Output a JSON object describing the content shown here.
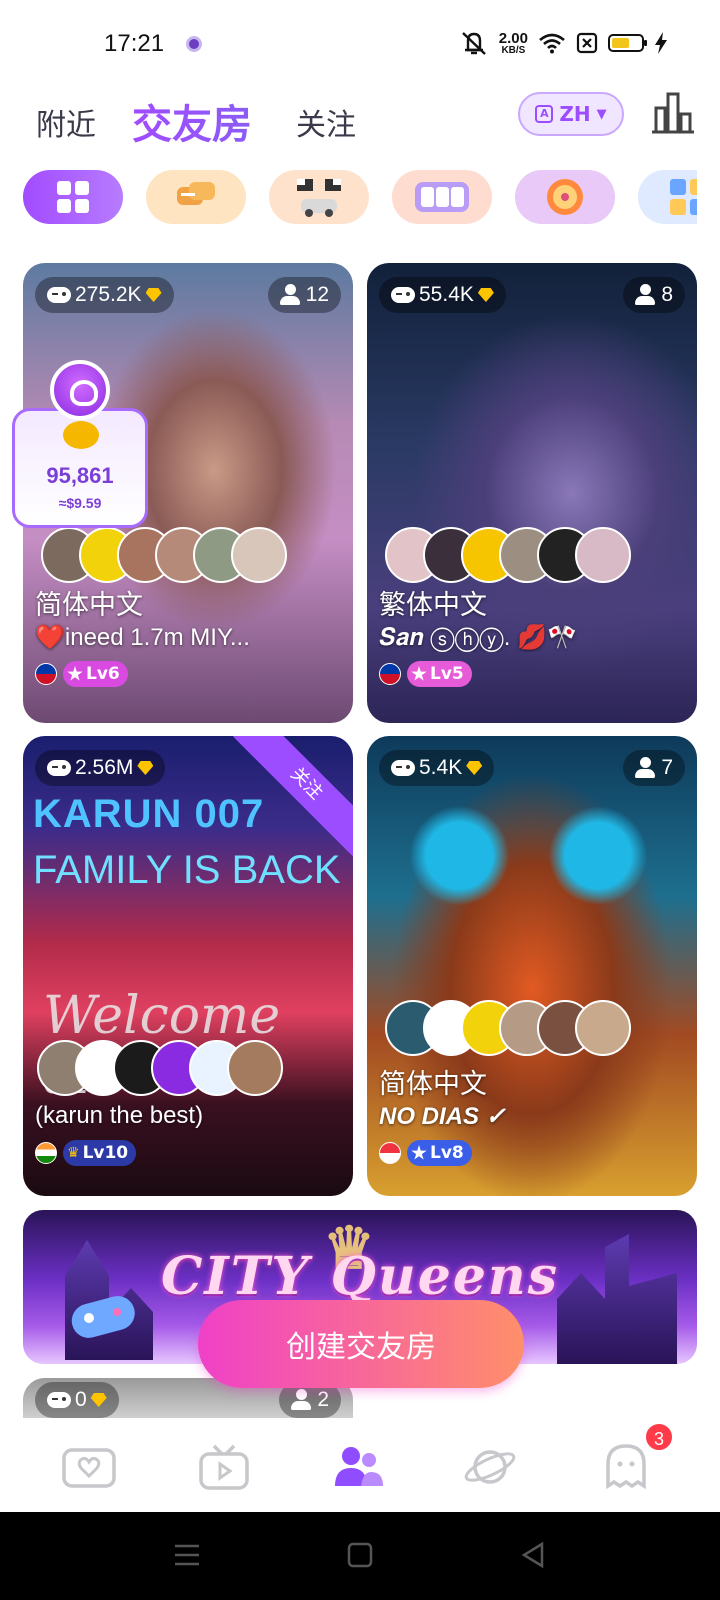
{
  "status_bar": {
    "time": "17:21",
    "net_speed": "2.00",
    "net_unit": "KB/S",
    "battery_level_percent": 60
  },
  "top_nav": {
    "tabs": [
      {
        "label": "附近",
        "active": false
      },
      {
        "label": "交友房",
        "active": true
      },
      {
        "label": "关注",
        "active": false
      }
    ],
    "language_button": "ZH"
  },
  "categories": [
    "grid-icon",
    "chat-icon",
    "racing-icon",
    "slot-icon",
    "wheel-icon",
    "dice-icon"
  ],
  "rooms": [
    {
      "score": "275.2K",
      "members": "12",
      "language": "简体中文",
      "title": "❤️ineed 1.7m  MIY...",
      "flag": "philippines",
      "level": "Lv6",
      "level_color": "#d94be0"
    },
    {
      "score": "55.4K",
      "members": "8",
      "language": "繁体中文",
      "title": "𝑺𝒂𝒏 ⓢⓗⓨ. 💋🎌",
      "flag": "philippines",
      "level": "Lv5",
      "level_color": "#e55bd8"
    },
    {
      "score": "2.56M",
      "members": "",
      "language": "",
      "title": "(karun the best)",
      "flag": "india",
      "level": "Lv10",
      "level_color": "#2c3aa8",
      "ribbon": "关注"
    },
    {
      "score": "5.4K",
      "members": "7",
      "language": "简体中文",
      "title": "  NO DIAS ✓",
      "flag": "singapore",
      "level": "Lv8",
      "level_color": "#3a5ee8"
    }
  ],
  "gift_widget": {
    "count": "95,861",
    "usd": "≈$9.59"
  },
  "banner": {
    "title": "CITY Queens"
  },
  "create_button": "创建交友房",
  "next_room": {
    "score": "0",
    "members": "2"
  },
  "bottom_nav": {
    "items": [
      "live-icon",
      "video-icon",
      "party-room-icon",
      "planet-icon",
      "messages-icon"
    ],
    "active_index": 2,
    "messages_badge": "3"
  },
  "colors": {
    "accent": "#9b4dff",
    "create_gradient_start": "#f040c8",
    "create_gradient_end": "#ff8f6a"
  }
}
